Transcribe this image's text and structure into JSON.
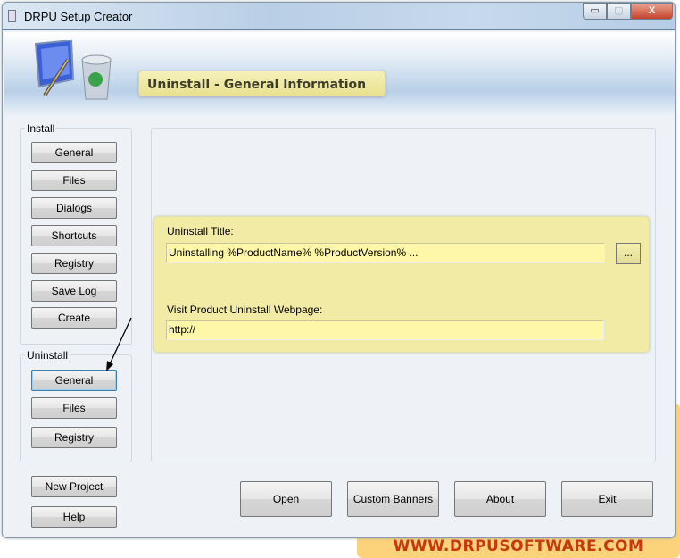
{
  "window": {
    "title": "DRPU Setup Creator",
    "minimize": "▭",
    "maximize": "▢",
    "close": "X"
  },
  "header": {
    "title": "Uninstall - General Information"
  },
  "install": {
    "label": "Install",
    "buttons": [
      "General",
      "Files",
      "Dialogs",
      "Shortcuts",
      "Registry",
      "Save Log",
      "Create"
    ]
  },
  "uninstall": {
    "label": "Uninstall",
    "buttons": [
      "General",
      "Files",
      "Registry"
    ],
    "selected": "General"
  },
  "project": {
    "new": "New Project",
    "help": "Help"
  },
  "form": {
    "title_label": "Uninstall Title:",
    "title_value": "Uninstalling %ProductName% %ProductVersion% ...",
    "browse": "...",
    "webpage_label": "Visit Product Uninstall Webpage:",
    "webpage_value": "http://"
  },
  "footer": {
    "buttons": [
      "Open",
      "Custom Banners",
      "About",
      "Exit"
    ]
  },
  "watermark": "WWW.DRPUSOFTWARE.COM"
}
